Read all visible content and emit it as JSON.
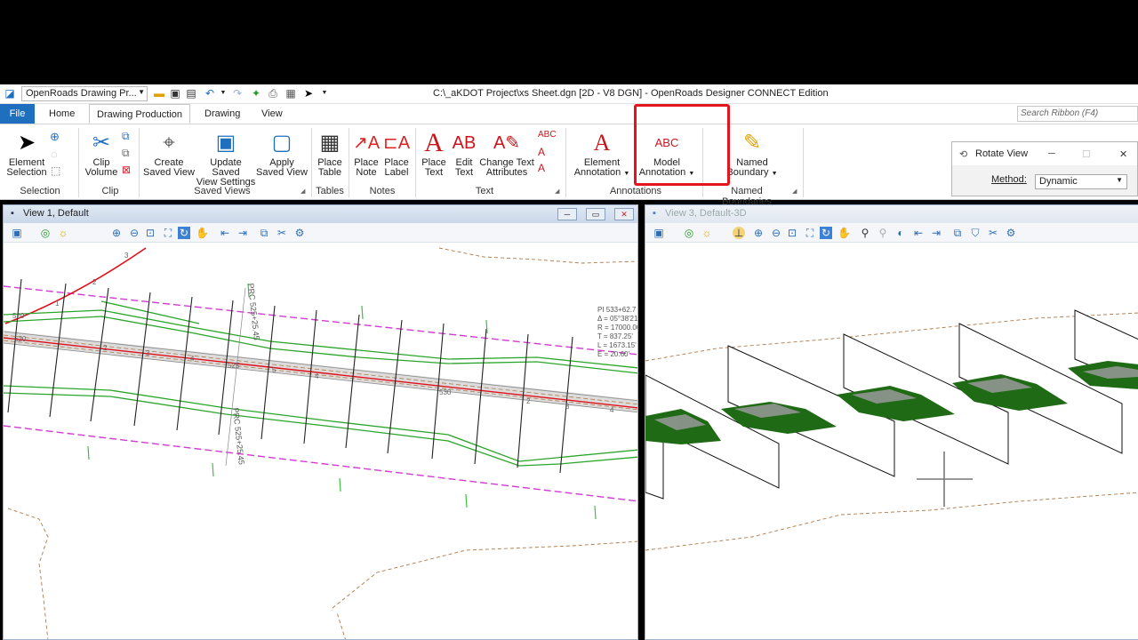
{
  "window": {
    "title": "C:\\_aKDOT Project\\xs Sheet.dgn [2D - V8 DGN] - OpenRoads Designer CONNECT Edition",
    "workflow": "OpenRoads Drawing Pr..."
  },
  "tabs": [
    "File",
    "Home",
    "Drawing Production",
    "Drawing",
    "View"
  ],
  "active_tab": "Drawing Production",
  "search_placeholder": "Search Ribbon (F4)",
  "ribbon": {
    "groups": {
      "selection": "Selection",
      "clip": "Clip",
      "saved_views": "Saved Views",
      "tables": "Tables",
      "notes": "Notes",
      "text": "Text",
      "annotations": "Annotations",
      "named_boundaries": "Named Boundaries"
    },
    "buttons": {
      "element_selection": [
        "Element",
        "Selection"
      ],
      "clip_volume": [
        "Clip",
        "Volume"
      ],
      "create_saved_view": [
        "Create",
        "Saved View"
      ],
      "update_saved_view": [
        "Update Saved",
        "View Settings"
      ],
      "apply_saved_view": [
        "Apply",
        "Saved View"
      ],
      "place_table": [
        "Place",
        "Table"
      ],
      "place_note": [
        "Place",
        "Note"
      ],
      "place_label": [
        "Place",
        "Label"
      ],
      "place_text": [
        "Place",
        "Text"
      ],
      "edit_text": [
        "Edit",
        "Text"
      ],
      "change_text_attributes": [
        "Change Text",
        "Attributes"
      ],
      "element_annotation": [
        "Element",
        "Annotation"
      ],
      "model_annotation": [
        "Model",
        "Annotation"
      ],
      "named_boundary": [
        "Named",
        "Boundary"
      ]
    }
  },
  "rotate_view": {
    "title": "Rotate View",
    "method_label": "Method:",
    "method_value": "Dynamic"
  },
  "views": {
    "view1_title": "View 1, Default",
    "view3_title": "View 3, Default-3D"
  },
  "plan_labels": {
    "prc1": "PRC 525+25.45",
    "prc2": "PRC 525+25.45",
    "curve": [
      "PI 533+62.7",
      "Δ = 05°38'21",
      "R = 17000.00",
      "T = 837.25'",
      "L = 1673.15'",
      "E = 20.60'"
    ],
    "stations": [
      "520",
      "525",
      "530",
      "620"
    ],
    "ticks": [
      "1",
      "2",
      "3",
      "4",
      "5",
      "2",
      "3",
      "4",
      "2",
      "3",
      "4"
    ]
  },
  "colors": {
    "file_tab": "#1f6fbf",
    "highlight_box": "#e4151c",
    "centerline": "#e0101a",
    "edge_lines": "#2aa52a",
    "row_lines": "#d23bd2",
    "terrain": "#b07a4a"
  }
}
